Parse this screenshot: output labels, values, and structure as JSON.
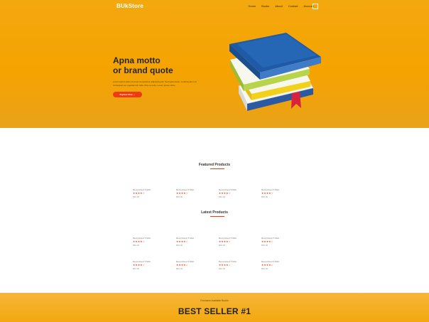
{
  "header": {
    "logo": "BUkStore",
    "menu": [
      "Home",
      "Books",
      "About",
      "Contact",
      "Account"
    ],
    "cart_icon": "cart-icon"
  },
  "hero": {
    "headline_line1": "Apna motto",
    "headline_line2": "or brand quote",
    "lede": "Lorem ipsum dolor sit amet consectetur adipiscing elit. Sed quam dolor, condimentum sit consequat vel, egestas elit nulla. Duis at enim. Lorem ipsum dolor.",
    "cta_label": "Explore Now →"
  },
  "featured": {
    "title": "Featured Products",
    "items": [
      {
        "name": "Red printed T-Shirt",
        "stars": "★★★★☆",
        "price": "$50.00"
      },
      {
        "name": "Red printed T-Shirt",
        "stars": "★★★★☆",
        "price": "$50.00"
      },
      {
        "name": "Red printed T-Shirt",
        "stars": "★★★★☆",
        "price": "$50.00"
      },
      {
        "name": "Red printed T-Shirt",
        "stars": "★★★★☆",
        "price": "$50.00"
      }
    ]
  },
  "latest": {
    "title": "Latest Products",
    "row1": [
      {
        "name": "Red printed T-Shirt",
        "stars": "★★★★☆",
        "price": "$50.00"
      },
      {
        "name": "Red printed T-Shirt",
        "stars": "★★★★☆",
        "price": "$50.00"
      },
      {
        "name": "Red printed T-Shirt",
        "stars": "★★★★☆",
        "price": "$50.00"
      },
      {
        "name": "Red printed T-Shirt",
        "stars": "★★★★☆",
        "price": "$50.00"
      }
    ],
    "row2": [
      {
        "name": "Red printed T-Shirt",
        "stars": "★★★★☆",
        "price": "$50.00"
      },
      {
        "name": "Red printed T-Shirt",
        "stars": "★★★★☆",
        "price": "$50.00"
      },
      {
        "name": "Red printed T-Shirt",
        "stars": "★★★★☆",
        "price": "$50.00"
      },
      {
        "name": "Red printed T-Shirt",
        "stars": "★★★★☆",
        "price": "$50.00"
      }
    ]
  },
  "promo": {
    "exclusive": "Exclusive Available Books",
    "headline": "BEST SELLER #1"
  },
  "colors": {
    "hero_bg": "#f5a300",
    "accent": "#ef3b12",
    "book_blue": "#1f5aa6",
    "book_green": "#b7d44b",
    "book_yellow": "#f2d11a"
  }
}
